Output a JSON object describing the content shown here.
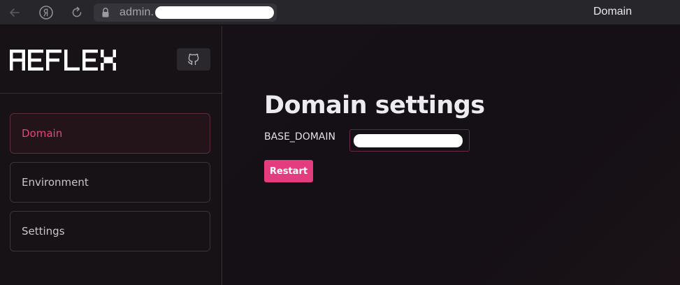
{
  "browser": {
    "url_prefix": "admin.",
    "tab_title": "Domain",
    "icons": {
      "back": "arrow-left-icon",
      "yandex": "yandex-logo-icon",
      "reload": "reload-icon",
      "lock": "lock-icon"
    }
  },
  "sidebar": {
    "logo": "REFLEX",
    "github_icon": "github-icon",
    "items": [
      {
        "label": "Domain",
        "active": true
      },
      {
        "label": "Environment",
        "active": false
      },
      {
        "label": "Settings",
        "active": false
      }
    ]
  },
  "main": {
    "title": "Domain settings",
    "field_label": "BASE_DOMAIN",
    "restart_label": "Restart"
  },
  "colors": {
    "accent": "#e33d80",
    "active_nav_text": "#e6457a",
    "background": "#141016"
  }
}
